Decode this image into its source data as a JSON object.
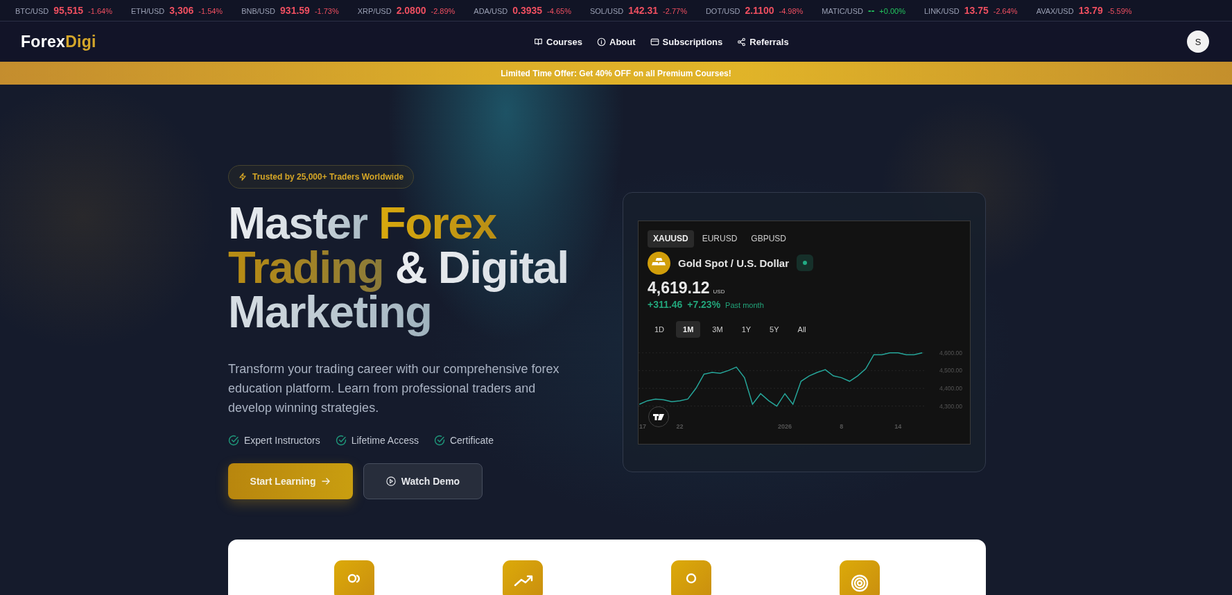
{
  "ticker": [
    {
      "symbol": "BTC/USD",
      "price": "95,515",
      "change": "-1.64%",
      "color": "#ef4f60"
    },
    {
      "symbol": "ETH/USD",
      "price": "3,306",
      "change": "-1.54%",
      "color": "#ef4f60"
    },
    {
      "symbol": "BNB/USD",
      "price": "931.59",
      "change": "-1.73%",
      "color": "#ef4f60"
    },
    {
      "symbol": "XRP/USD",
      "price": "2.0800",
      "change": "-2.89%",
      "color": "#ef4f60"
    },
    {
      "symbol": "ADA/USD",
      "price": "0.3935",
      "change": "-4.65%",
      "color": "#ef4f60"
    },
    {
      "symbol": "SOL/USD",
      "price": "142.31",
      "change": "-2.77%",
      "color": "#ef4f60"
    },
    {
      "symbol": "DOT/USD",
      "price": "2.1100",
      "change": "-4.98%",
      "color": "#ef4f60"
    },
    {
      "symbol": "MATIC/USD",
      "price": "--",
      "change": "+0.00%",
      "color": "#22c55e"
    },
    {
      "symbol": "LINK/USD",
      "price": "13.75",
      "change": "-2.64%",
      "color": "#ef4f60"
    },
    {
      "symbol": "AVAX/USD",
      "price": "13.79",
      "change": "-5.59%",
      "color": "#ef4f60"
    }
  ],
  "logo": {
    "first": "Forex",
    "second": "Digi"
  },
  "nav": [
    {
      "label": "Courses"
    },
    {
      "label": "About"
    },
    {
      "label": "Subscriptions"
    },
    {
      "label": "Referrals"
    }
  ],
  "avatar": "S",
  "promo": "Limited Time Offer: Get 40% OFF on all Premium Courses!",
  "badge": "Trusted by 25,000+ Traders Worldwide",
  "title": [
    {
      "text": "Master ",
      "accent": false
    },
    {
      "text": "Forex Trading",
      "accent": true
    },
    {
      "text": " & Digital Marketing",
      "accent": false
    }
  ],
  "description": "Transform your trading career with our comprehensive forex education platform. Learn from professional traders and develop winning strategies.",
  "features": [
    "Expert Instructors",
    "Lifetime Access",
    "Certificate"
  ],
  "buttons": [
    {
      "label": "Start Learning",
      "kind": "primary"
    },
    {
      "label": "Watch Demo",
      "kind": "secondary"
    }
  ],
  "widget": {
    "symbols": [
      {
        "label": "XAUUSD",
        "selected": true
      },
      {
        "label": "EURUSD",
        "selected": false
      },
      {
        "label": "GBPUSD",
        "selected": false
      }
    ],
    "name": "Gold Spot / U.S. Dollar",
    "price": "4,619.12",
    "currency": "USD",
    "change": "+311.46",
    "change_pct": "+7.23%",
    "period": "Past month",
    "ranges": [
      {
        "label": "1D",
        "selected": false
      },
      {
        "label": "1M",
        "selected": true
      },
      {
        "label": "3M",
        "selected": false
      },
      {
        "label": "1Y",
        "selected": false
      },
      {
        "label": "5Y",
        "selected": false
      },
      {
        "label": "All",
        "selected": false
      }
    ],
    "chart_data": {
      "type": "line",
      "categories": [
        "17",
        null,
        null,
        null,
        null,
        "22",
        null,
        null,
        null,
        null,
        null,
        null,
        null,
        null,
        null,
        null,
        null,
        null,
        "2026",
        null,
        null,
        null,
        null,
        null,
        null,
        "8",
        null,
        null,
        null,
        null,
        null,
        null,
        "14",
        null,
        null,
        null
      ],
      "series": [
        {
          "color": "#26a69a",
          "values": [
            4310,
            4330,
            4340,
            4335,
            4325,
            4330,
            4340,
            4400,
            4480,
            4490,
            4485,
            4500,
            4520,
            4460,
            4310,
            4370,
            4330,
            4300,
            4370,
            4310,
            4440,
            4470,
            4490,
            4505,
            4470,
            4460,
            4440,
            4470,
            4510,
            4590,
            4590,
            4600,
            4600,
            4590,
            4590,
            4600
          ]
        }
      ],
      "grid": true,
      "ylim": [
        4300,
        4600
      ],
      "yticks": [
        {
          "value": 4300,
          "label": "4,300.00"
        },
        {
          "value": 4400,
          "label": "4,400.00"
        },
        {
          "value": 4500,
          "label": "4,500.00"
        },
        {
          "value": 4600,
          "label": "4,600.00"
        }
      ]
    }
  },
  "cards": [
    {
      "kind": "users"
    },
    {
      "kind": "trend"
    },
    {
      "kind": "user"
    },
    {
      "kind": "target"
    }
  ]
}
